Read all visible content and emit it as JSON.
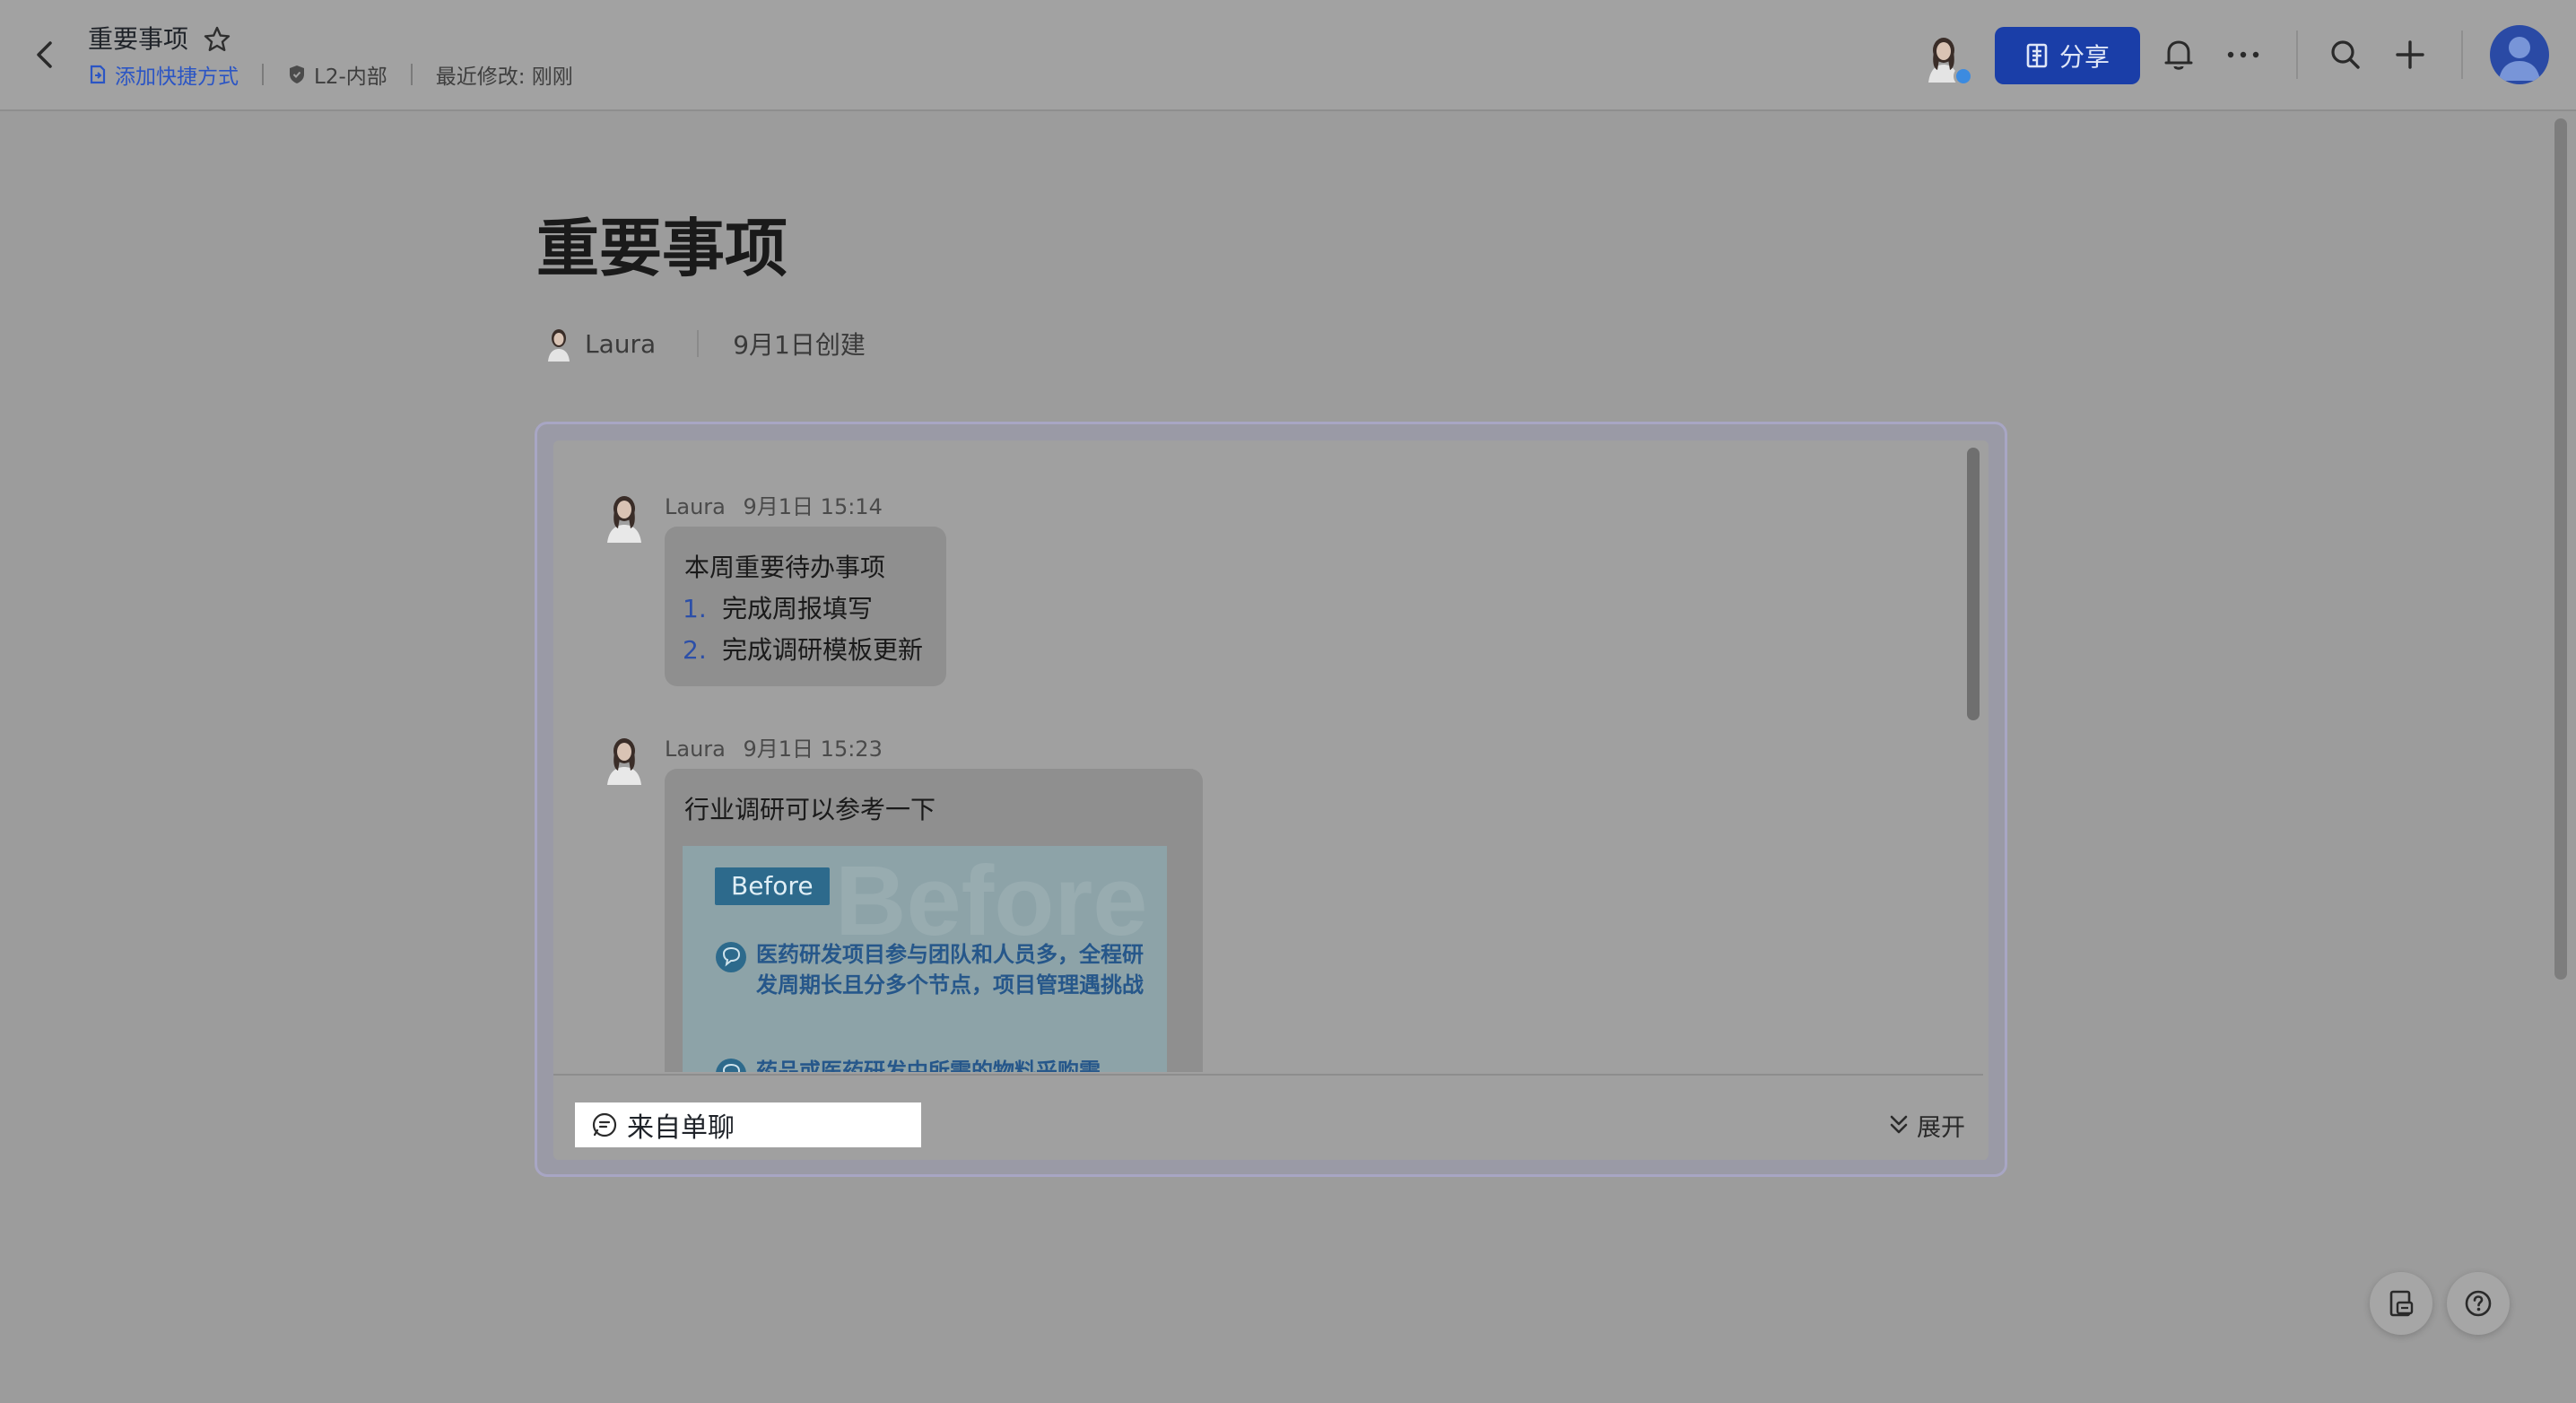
{
  "header": {
    "doc_title": "重要事项",
    "add_shortcut": "添加快捷方式",
    "security_level": "L2-内部",
    "last_modified": "最近修改: 刚刚",
    "share_label": "分享"
  },
  "doc": {
    "title": "重要事项",
    "author": "Laura",
    "created": "9月1日创建"
  },
  "chat_card": {
    "messages": [
      {
        "sender": "Laura",
        "time": "9月1日 15:14",
        "text": "本周重要待办事项",
        "list": [
          {
            "num": "1.",
            "text": "完成周报填写"
          },
          {
            "num": "2.",
            "text": "完成调研模板更新"
          }
        ]
      },
      {
        "sender": "Laura",
        "time": "9月1日 15:23",
        "text": "行业调研可以参考一下",
        "preview": {
          "tag": "Before",
          "watermark": "Before",
          "items": [
            "医药研发项目参与团队和人员多，全程研发周期长且分多个节点，项目管理遇挑战",
            "药品或医药研发中所需的物料采购需"
          ]
        }
      }
    ],
    "source_label": "来自单聊",
    "expand_label": "展开"
  },
  "colors": {
    "share_button": "#1a3ea8",
    "link": "#2b55c4",
    "list_number": "#2c4fa8",
    "before_tag": "#2d6a8c"
  },
  "icons": {
    "back": "chevron-left-icon",
    "star": "star-outline-icon",
    "shortcut": "shortcut-icon",
    "shield": "shield-icon",
    "share": "share-doc-icon",
    "bell": "bell-icon",
    "more": "more-dots-icon",
    "search": "search-icon",
    "add": "plus-icon",
    "chat": "chat-bubble-icon",
    "expand": "double-chevron-down-icon",
    "doc_outline": "doc-outline-icon",
    "help": "help-circle-icon"
  }
}
